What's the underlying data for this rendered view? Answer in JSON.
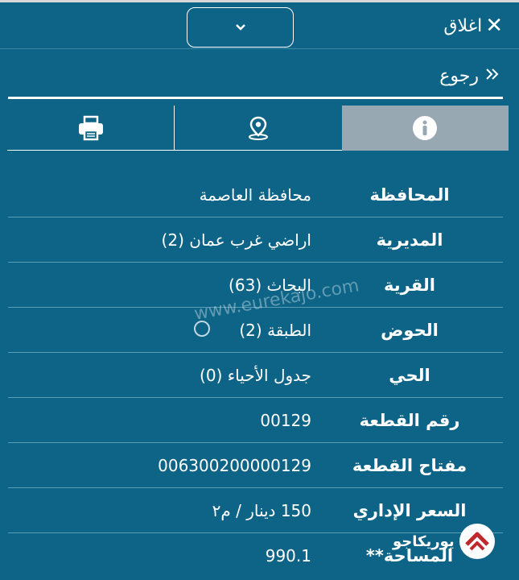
{
  "header": {
    "close_label": "اغلاق"
  },
  "back": {
    "label": "رجوع"
  },
  "tabs": [
    {
      "name": "print",
      "icon": "print-icon"
    },
    {
      "name": "location",
      "icon": "map-pin-icon"
    },
    {
      "name": "info",
      "icon": "info-icon",
      "active": true
    }
  ],
  "details": [
    {
      "label": "المحافظة",
      "value": "محافظة العاصمة"
    },
    {
      "label": "المديرية",
      "value": "اراضي غرب عمان (2)"
    },
    {
      "label": "القرية",
      "value": "البحاث (63)"
    },
    {
      "label": "الحوض",
      "value": "الطبقة (2)"
    },
    {
      "label": "الحي",
      "value": "جدول الأحياء (0)"
    },
    {
      "label": "رقم القطعة",
      "value": "00129"
    },
    {
      "label": "مفتاح القطعة",
      "value": "006300200000129"
    },
    {
      "label": "السعر الإداري",
      "value": "150 دينار / م٢"
    },
    {
      "label": "المساحة**",
      "value": "990.1"
    }
  ],
  "watermark": {
    "text": "www.eurekajo.com"
  },
  "logo": {
    "text": "يوريكاجو"
  },
  "colors": {
    "background": "#0d6487",
    "active_tab": "#98a8b2",
    "text": "#ffffff"
  }
}
